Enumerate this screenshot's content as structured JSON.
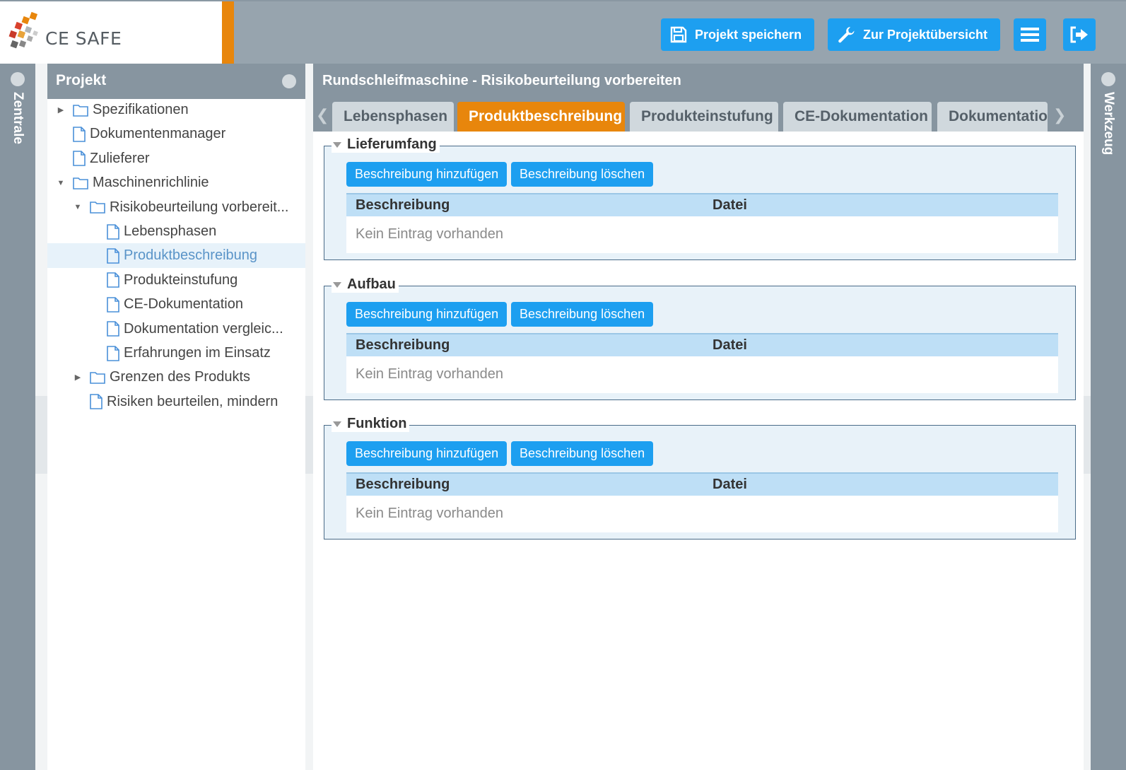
{
  "header": {
    "logo_text": "CE SAFE",
    "save_label": "Projekt speichern",
    "overview_label": "Zur Projektübersicht"
  },
  "left_rail": {
    "label": "Zentrale"
  },
  "right_rail": {
    "label": "Werkzeug"
  },
  "tree": {
    "title": "Projekt",
    "items": [
      {
        "label": "Spezifikationen",
        "type": "folder",
        "caret": "right"
      },
      {
        "label": "Dokumentenmanager",
        "type": "file"
      },
      {
        "label": "Zulieferer",
        "type": "file"
      },
      {
        "label": "Maschinenrichlinie",
        "type": "folder",
        "caret": "down"
      },
      {
        "label": "Risikobeurteilung vorbereit...",
        "type": "folder",
        "caret": "down"
      },
      {
        "label": "Lebensphasen",
        "type": "file"
      },
      {
        "label": "Produktbeschreibung",
        "type": "file",
        "selected": true
      },
      {
        "label": "Produkteinstufung",
        "type": "file"
      },
      {
        "label": "CE-Dokumentation",
        "type": "file"
      },
      {
        "label": "Dokumentation vergleic...",
        "type": "file"
      },
      {
        "label": "Erfahrungen im Einsatz",
        "type": "file"
      },
      {
        "label": "Grenzen des Produkts",
        "type": "folder",
        "caret": "right"
      },
      {
        "label": "Risiken beurteilen, mindern",
        "type": "file"
      }
    ]
  },
  "main": {
    "title": "Rundschleifmaschine - Risikobeurteilung vorbereiten",
    "tabs": [
      {
        "label": "Lebensphasen"
      },
      {
        "label": "Produktbeschreibung",
        "active": true
      },
      {
        "label": "Produkteinstufung"
      },
      {
        "label": "CE-Dokumentation"
      },
      {
        "label": "Dokumentatio"
      }
    ],
    "sections": [
      {
        "title": "Lieferumfang",
        "add_label": "Beschreibung hinzufügen",
        "delete_label": "Beschreibung löschen",
        "col1": "Beschreibung",
        "col2": "Datei",
        "empty": "Kein Eintrag vorhanden"
      },
      {
        "title": "Aufbau",
        "add_label": "Beschreibung hinzufügen",
        "delete_label": "Beschreibung löschen",
        "col1": "Beschreibung",
        "col2": "Datei",
        "empty": "Kein Eintrag vorhanden"
      },
      {
        "title": "Funktion",
        "add_label": "Beschreibung hinzufügen",
        "delete_label": "Beschreibung löschen",
        "col1": "Beschreibung",
        "col2": "Datei",
        "empty": "Kein Eintrag vorhanden"
      }
    ]
  },
  "colors": {
    "accent_orange": "#e8860c",
    "button_blue": "#1d9ff0",
    "panel_gray": "#8795a0"
  }
}
